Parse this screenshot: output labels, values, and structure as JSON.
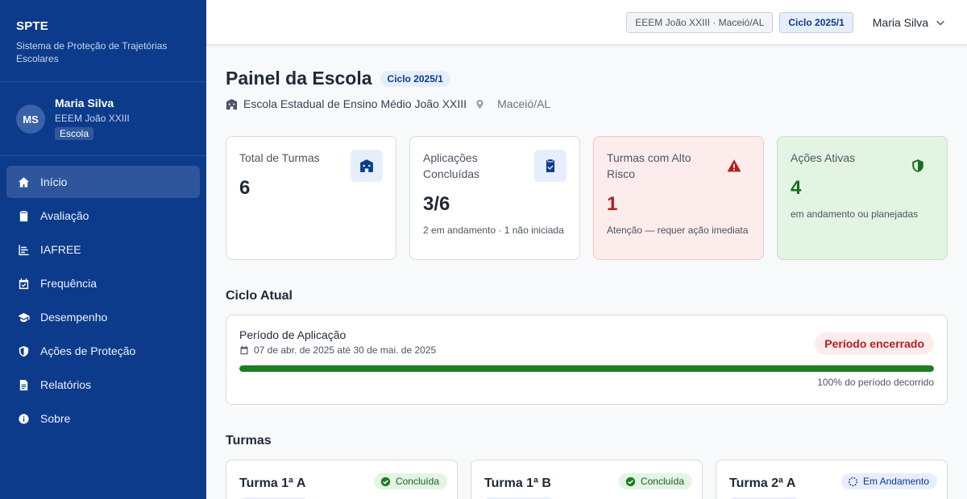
{
  "sidebar": {
    "brand_title": "SPTE",
    "brand_subtitle": "Sistema de Proteção de Trajetórias Escolares",
    "user": {
      "initials": "MS",
      "name": "Maria Silva",
      "school": "EEEM João XXIII",
      "role": "Escola"
    },
    "items": [
      {
        "label": "Início",
        "icon": "home-icon",
        "active": true
      },
      {
        "label": "Avaliação",
        "icon": "clipboard-icon"
      },
      {
        "label": "IAFREE",
        "icon": "chart-bars-icon"
      },
      {
        "label": "Frequência",
        "icon": "calendar-check-icon"
      },
      {
        "label": "Desempenho",
        "icon": "graduation-cap-icon"
      },
      {
        "label": "Ações de Proteção",
        "icon": "shield-icon"
      },
      {
        "label": "Relatórios",
        "icon": "report-icon"
      },
      {
        "label": "Sobre",
        "icon": "info-icon"
      }
    ]
  },
  "topbar": {
    "school_chip": "EEEM João XXIII · Maceió/AL",
    "cycle_chip": "Ciclo 2025/1",
    "user_name": "Maria Silva"
  },
  "header": {
    "title": "Painel da Escola",
    "cycle_badge": "Ciclo 2025/1",
    "school_full": "Escola Estadual de Ensino Médio João XXIII",
    "location": "Maceió/AL"
  },
  "cards": [
    {
      "label": "Total de Turmas",
      "value": "6",
      "note": "",
      "icon": "school-icon"
    },
    {
      "label": "Aplicações Concluídas",
      "value": "3/6",
      "note": "2 em andamento · 1 não iniciada",
      "icon": "clipboard-check-icon"
    },
    {
      "label": "Turmas com Alto Risco",
      "value": "1",
      "note": "Atenção — requer ação imediata",
      "icon": "warning-icon"
    },
    {
      "label": "Ações Ativas",
      "value": "4",
      "note": "em andamento ou planejadas",
      "icon": "shield-check-icon"
    }
  ],
  "colors": {
    "primary": "#0d3b8c",
    "danger": "#b71c1c",
    "success": "#1b6e20",
    "progress": "#1e7d22"
  },
  "cycle": {
    "section_title": "Ciclo Atual",
    "period_label": "Período de Aplicação",
    "period_dates": "07 de abr. de 2025 até 30 de mai. de 2025",
    "status": "Período encerrado",
    "progress_percent": 100,
    "progress_text": "100% do período decorrido"
  },
  "turmas": {
    "section_title": "Turmas",
    "items": [
      {
        "name": "Turma 1ª A",
        "status": "Concluída",
        "state": "done"
      },
      {
        "name": "Turma 1ª B",
        "status": "Concluída",
        "state": "done"
      },
      {
        "name": "Turma 2ª A",
        "status": "Em Andamento",
        "state": "progress"
      }
    ]
  }
}
